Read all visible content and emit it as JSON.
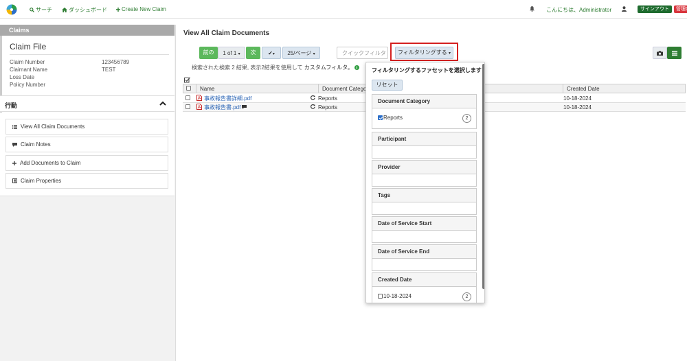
{
  "nav": {
    "search": "サーチ",
    "dashboard": "ダッシュボード",
    "create_claim": "Create New Claim",
    "greeting": "こんにちは、Administrator",
    "signout": "サインアウト",
    "admin": "管理者"
  },
  "sidebar": {
    "header": "Claims",
    "claim_file_title": "Claim File",
    "fields": [
      {
        "label": "Claim Number",
        "value": "123456789"
      },
      {
        "label": "Claimant Name",
        "value": "TEST"
      },
      {
        "label": "Loss Date",
        "value": ""
      },
      {
        "label": "Policy Number",
        "value": ""
      }
    ],
    "actions_title": "行動",
    "actions": [
      {
        "label": "View All Claim Documents",
        "icon": "list-icon"
      },
      {
        "label": "Claim Notes",
        "icon": "comment-icon"
      },
      {
        "label": "Add Documents to Claim",
        "icon": "plus-icon"
      },
      {
        "label": "Claim Properties",
        "icon": "properties-icon"
      }
    ]
  },
  "main": {
    "title": "View All Claim Documents",
    "prev": "前の",
    "page": "1 of 1",
    "next": "次",
    "per_page": "25/ページ",
    "quick_filter_placeholder": "クイックフィルタ",
    "filter_button": "フィルタリングする",
    "result_text": "検索された検索 2 結果, 表示2結果を使用して",
    "custom_filter": "カスタムフィルタ。",
    "columns": [
      "Name",
      "Document Category",
      "Created Date"
    ],
    "rows": [
      {
        "name": "事故報告書詳細.pdf",
        "category": "Reports",
        "date": "10-18-2024"
      },
      {
        "name": "事故報告書.pdf",
        "category": "Reports",
        "date": "10-18-2024"
      }
    ]
  },
  "dropdown": {
    "title": "フィルタリングするファセットを選択します",
    "reset": "リセット",
    "facets": [
      {
        "name": "Document Category",
        "option": "Reports",
        "checked": true,
        "count": "2"
      },
      {
        "name": "Participant",
        "option": "",
        "count": ""
      },
      {
        "name": "Provider",
        "option": "",
        "count": ""
      },
      {
        "name": "Tags",
        "option": "",
        "count": ""
      },
      {
        "name": "Date of Service Start",
        "option": "",
        "count": ""
      },
      {
        "name": "Date of Service End",
        "option": "",
        "count": ""
      },
      {
        "name": "Created Date",
        "option": "10-18-2024",
        "checked": false,
        "count": "2"
      }
    ]
  },
  "colors": {
    "accent_green": "#2e7d32",
    "signout_bg": "#1e6b2e",
    "admin_bg": "#d9363e",
    "highlight_red": "#d42020",
    "link_blue": "#2a64b5"
  }
}
